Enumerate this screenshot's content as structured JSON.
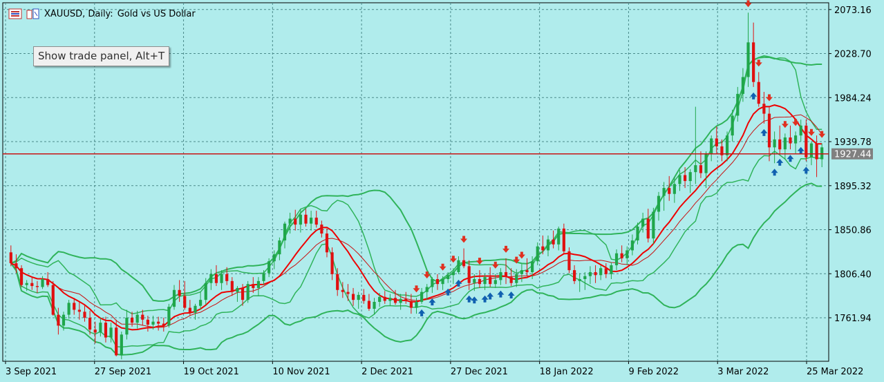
{
  "header": {
    "symbol_title": "XAUUSD, Daily:",
    "description": "Gold vs US Dollar",
    "menu_icon": "menu-list-icon",
    "chart_icon": "chart-window-icon"
  },
  "tooltip": {
    "text": "Show trade panel, Alt+T"
  },
  "colors": {
    "background": "#b0ecec",
    "bull": "#1fa64a",
    "bear": "#e01010",
    "band": "#2fb35a",
    "ma_fast": "#ee0000",
    "ma_slow": "#c81010",
    "price_line": "#c81414",
    "buy_arrow": "#1060b0",
    "sell_arrow": "#e03020",
    "price_label_bg": "#808080"
  },
  "chart_data": {
    "type": "candlestick",
    "symbol": "XAUUSD",
    "timeframe": "Daily",
    "ylim": [
      1718,
      2080
    ],
    "y_ticks": [
      "2073.16",
      "2028.70",
      "1984.24",
      "1939.78",
      "1895.32",
      "1850.86",
      "1806.40",
      "1761.94"
    ],
    "x_ticks": [
      "3 Sep 2021",
      "27 Sep 2021",
      "19 Oct 2021",
      "10 Nov 2021",
      "2 Dec 2021",
      "27 Dec 2021",
      "18 Jan 2022",
      "9 Feb 2022",
      "3 Mar 2022",
      "25 Mar 2022"
    ],
    "current_price": "1927.44",
    "grid": true,
    "candles": [
      [
        1828,
        1835,
        1814,
        1817
      ],
      [
        1817,
        1826,
        1807,
        1812
      ],
      [
        1812,
        1815,
        1793,
        1795
      ],
      [
        1795,
        1800,
        1789,
        1797
      ],
      [
        1797,
        1803,
        1790,
        1794
      ],
      [
        1794,
        1799,
        1787,
        1793
      ],
      [
        1793,
        1804,
        1791,
        1801
      ],
      [
        1801,
        1808,
        1793,
        1795
      ],
      [
        1795,
        1799,
        1764,
        1765
      ],
      [
        1765,
        1772,
        1745,
        1754
      ],
      [
        1754,
        1768,
        1749,
        1765
      ],
      [
        1765,
        1780,
        1761,
        1777
      ],
      [
        1777,
        1782,
        1765,
        1770
      ],
      [
        1770,
        1778,
        1760,
        1768
      ],
      [
        1768,
        1775,
        1758,
        1762
      ],
      [
        1762,
        1769,
        1745,
        1750
      ],
      [
        1750,
        1758,
        1736,
        1747
      ],
      [
        1747,
        1762,
        1743,
        1757
      ],
      [
        1757,
        1763,
        1737,
        1742
      ],
      [
        1742,
        1757,
        1737,
        1752
      ],
      [
        1752,
        1760,
        1723,
        1724
      ],
      [
        1724,
        1748,
        1720,
        1745
      ],
      [
        1745,
        1770,
        1740,
        1762
      ],
      [
        1762,
        1768,
        1753,
        1757
      ],
      [
        1757,
        1769,
        1751,
        1765
      ],
      [
        1765,
        1770,
        1754,
        1760
      ],
      [
        1760,
        1764,
        1748,
        1755
      ],
      [
        1755,
        1764,
        1750,
        1758
      ],
      [
        1758,
        1763,
        1749,
        1756
      ],
      [
        1756,
        1762,
        1748,
        1754
      ],
      [
        1754,
        1776,
        1752,
        1773
      ],
      [
        1773,
        1795,
        1770,
        1790
      ],
      [
        1790,
        1800,
        1778,
        1784
      ],
      [
        1784,
        1799,
        1770,
        1772
      ],
      [
        1772,
        1780,
        1764,
        1767
      ],
      [
        1767,
        1776,
        1760,
        1774
      ],
      [
        1774,
        1788,
        1770,
        1780
      ],
      [
        1780,
        1802,
        1775,
        1797
      ],
      [
        1797,
        1811,
        1790,
        1806
      ],
      [
        1806,
        1815,
        1794,
        1797
      ],
      [
        1797,
        1810,
        1790,
        1806
      ],
      [
        1806,
        1813,
        1795,
        1799
      ],
      [
        1799,
        1803,
        1784,
        1788
      ],
      [
        1788,
        1794,
        1778,
        1792
      ],
      [
        1792,
        1796,
        1774,
        1780
      ],
      [
        1780,
        1799,
        1777,
        1796
      ],
      [
        1796,
        1803,
        1787,
        1792
      ],
      [
        1792,
        1803,
        1784,
        1799
      ],
      [
        1799,
        1810,
        1795,
        1807
      ],
      [
        1807,
        1822,
        1803,
        1819
      ],
      [
        1819,
        1830,
        1811,
        1826
      ],
      [
        1826,
        1843,
        1820,
        1840
      ],
      [
        1840,
        1859,
        1832,
        1857
      ],
      [
        1857,
        1868,
        1847,
        1862
      ],
      [
        1862,
        1871,
        1850,
        1856
      ],
      [
        1856,
        1872,
        1848,
        1866
      ],
      [
        1866,
        1872,
        1854,
        1857
      ],
      [
        1857,
        1870,
        1850,
        1863
      ],
      [
        1863,
        1870,
        1853,
        1856
      ],
      [
        1856,
        1860,
        1843,
        1847
      ],
      [
        1847,
        1852,
        1823,
        1828
      ],
      [
        1828,
        1833,
        1800,
        1806
      ],
      [
        1806,
        1812,
        1784,
        1790
      ],
      [
        1790,
        1798,
        1782,
        1788
      ],
      [
        1788,
        1796,
        1779,
        1786
      ],
      [
        1786,
        1792,
        1774,
        1780
      ],
      [
        1780,
        1788,
        1771,
        1785
      ],
      [
        1785,
        1791,
        1776,
        1779
      ],
      [
        1779,
        1786,
        1769,
        1771
      ],
      [
        1771,
        1782,
        1765,
        1778
      ],
      [
        1778,
        1787,
        1773,
        1783
      ],
      [
        1783,
        1789,
        1776,
        1779
      ],
      [
        1779,
        1786,
        1774,
        1782
      ],
      [
        1782,
        1790,
        1775,
        1777
      ],
      [
        1777,
        1786,
        1770,
        1781
      ],
      [
        1781,
        1788,
        1776,
        1779
      ],
      [
        1779,
        1786,
        1766,
        1772
      ],
      [
        1772,
        1782,
        1766,
        1778
      ],
      [
        1778,
        1792,
        1776,
        1788
      ],
      [
        1788,
        1796,
        1780,
        1793
      ],
      [
        1793,
        1803,
        1787,
        1801
      ],
      [
        1801,
        1806,
        1790,
        1796
      ],
      [
        1796,
        1804,
        1790,
        1801
      ],
      [
        1801,
        1808,
        1797,
        1805
      ],
      [
        1805,
        1812,
        1796,
        1808
      ],
      [
        1808,
        1824,
        1806,
        1820
      ],
      [
        1820,
        1832,
        1812,
        1814
      ],
      [
        1814,
        1820,
        1790,
        1797
      ],
      [
        1797,
        1806,
        1789,
        1801
      ],
      [
        1801,
        1810,
        1792,
        1796
      ],
      [
        1796,
        1806,
        1790,
        1803
      ],
      [
        1803,
        1813,
        1793,
        1796
      ],
      [
        1796,
        1806,
        1792,
        1800
      ],
      [
        1800,
        1812,
        1795,
        1808
      ],
      [
        1808,
        1822,
        1796,
        1803
      ],
      [
        1803,
        1812,
        1794,
        1797
      ],
      [
        1797,
        1811,
        1793,
        1806
      ],
      [
        1806,
        1816,
        1798,
        1810
      ],
      [
        1810,
        1822,
        1804,
        1808
      ],
      [
        1808,
        1824,
        1801,
        1819
      ],
      [
        1819,
        1838,
        1815,
        1834
      ],
      [
        1834,
        1845,
        1826,
        1830
      ],
      [
        1830,
        1845,
        1824,
        1841
      ],
      [
        1841,
        1850,
        1832,
        1836
      ],
      [
        1836,
        1854,
        1830,
        1852
      ],
      [
        1852,
        1857,
        1827,
        1829
      ],
      [
        1829,
        1833,
        1807,
        1810
      ],
      [
        1810,
        1815,
        1796,
        1799
      ],
      [
        1799,
        1807,
        1788,
        1801
      ],
      [
        1801,
        1808,
        1790,
        1804
      ],
      [
        1804,
        1814,
        1796,
        1808
      ],
      [
        1808,
        1815,
        1797,
        1805
      ],
      [
        1805,
        1815,
        1800,
        1812
      ],
      [
        1812,
        1817,
        1802,
        1806
      ],
      [
        1806,
        1818,
        1801,
        1815
      ],
      [
        1815,
        1831,
        1810,
        1827
      ],
      [
        1827,
        1835,
        1818,
        1822
      ],
      [
        1822,
        1834,
        1815,
        1830
      ],
      [
        1830,
        1846,
        1825,
        1840
      ],
      [
        1840,
        1858,
        1836,
        1854
      ],
      [
        1854,
        1868,
        1848,
        1862
      ],
      [
        1862,
        1872,
        1838,
        1842
      ],
      [
        1842,
        1873,
        1836,
        1869
      ],
      [
        1869,
        1889,
        1860,
        1885
      ],
      [
        1885,
        1899,
        1870,
        1893
      ],
      [
        1893,
        1905,
        1880,
        1887
      ],
      [
        1887,
        1904,
        1878,
        1897
      ],
      [
        1897,
        1911,
        1890,
        1906
      ],
      [
        1906,
        1914,
        1893,
        1900
      ],
      [
        1900,
        1912,
        1888,
        1909
      ],
      [
        1909,
        1975,
        1897,
        1916
      ],
      [
        1916,
        1930,
        1903,
        1908
      ],
      [
        1908,
        1930,
        1893,
        1928
      ],
      [
        1928,
        1946,
        1920,
        1943
      ],
      [
        1943,
        1955,
        1928,
        1935
      ],
      [
        1935,
        1942,
        1920,
        1926
      ],
      [
        1926,
        1950,
        1920,
        1946
      ],
      [
        1946,
        1972,
        1940,
        1966
      ],
      [
        1966,
        1995,
        1960,
        1988
      ],
      [
        1988,
        2014,
        1980,
        2005
      ],
      [
        2005,
        2070,
        1995,
        2040
      ],
      [
        2040,
        2060,
        1995,
        2000
      ],
      [
        2000,
        2010,
        1975,
        1978
      ],
      [
        1978,
        1990,
        1958,
        1968
      ],
      [
        1968,
        1975,
        1920,
        1934
      ],
      [
        1934,
        1950,
        1918,
        1942
      ],
      [
        1942,
        1956,
        1928,
        1932
      ],
      [
        1932,
        1948,
        1922,
        1944
      ],
      [
        1944,
        1956,
        1932,
        1938
      ],
      [
        1938,
        1950,
        1928,
        1946
      ],
      [
        1946,
        1962,
        1940,
        1956
      ],
      [
        1956,
        1962,
        1920,
        1924
      ],
      [
        1924,
        1940,
        1916,
        1938
      ],
      [
        1938,
        1946,
        1904,
        1922
      ],
      [
        1922,
        1938,
        1914,
        1934
      ]
    ]
  }
}
